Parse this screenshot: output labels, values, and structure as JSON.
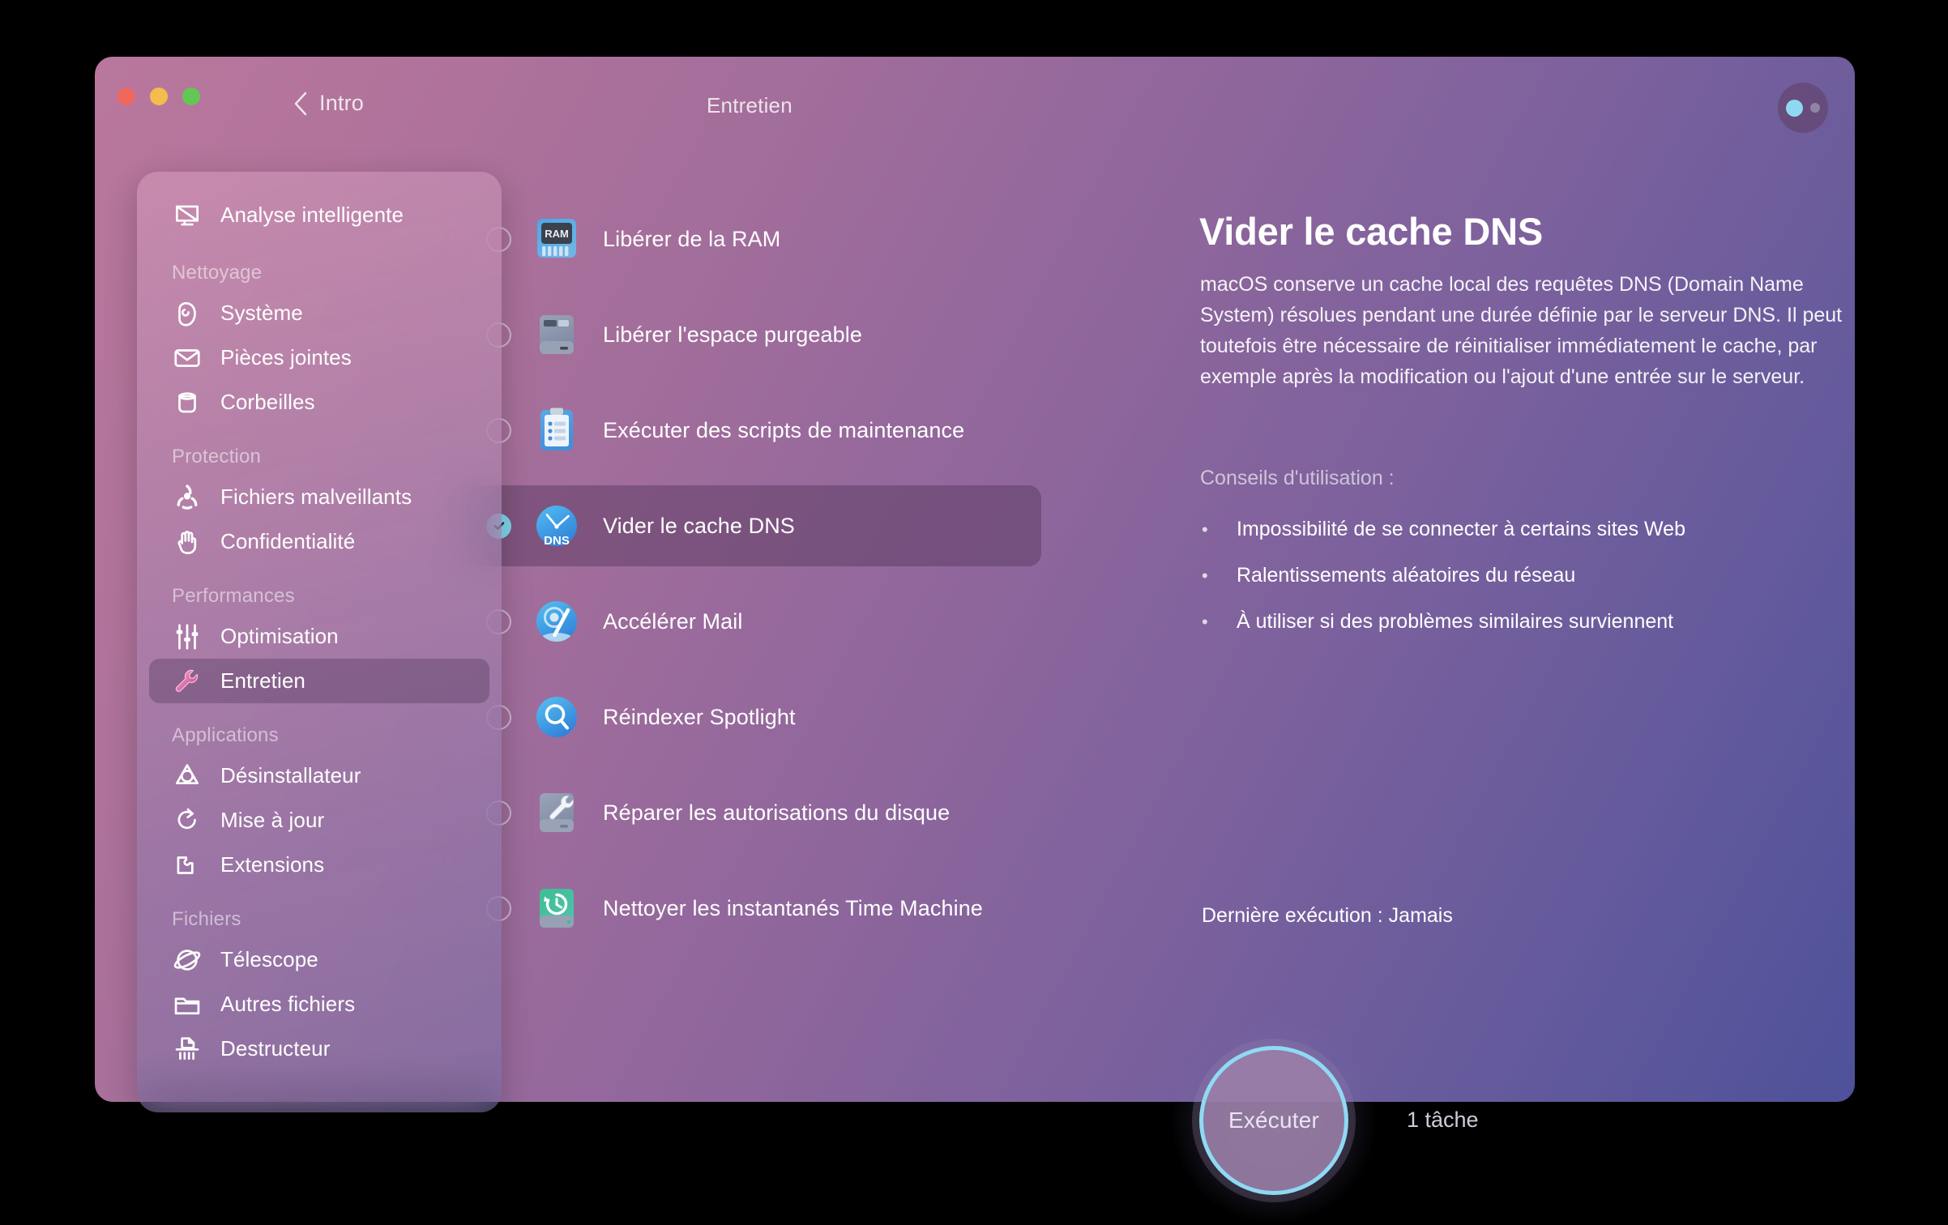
{
  "window": {
    "traffic_lights": [
      "close",
      "minimize",
      "zoom"
    ],
    "back_label": "Intro",
    "section_title": "Entretien",
    "accent_color": "#8fd9f4",
    "window_gradient_from": "#b9779c",
    "window_gradient_to": "#4e519a"
  },
  "sidebar": {
    "top_item": {
      "label": "Analyse intelligente",
      "icon": "smart-scan-icon"
    },
    "groups": [
      {
        "title": "Nettoyage",
        "items": [
          {
            "label": "Système",
            "icon": "system-junk-icon"
          },
          {
            "label": "Pièces jointes",
            "icon": "mail-attachments-icon"
          },
          {
            "label": "Corbeilles",
            "icon": "trash-bins-icon"
          }
        ]
      },
      {
        "title": "Protection",
        "items": [
          {
            "label": "Fichiers malveillants",
            "icon": "biohazard-icon"
          },
          {
            "label": "Confidentialité",
            "icon": "privacy-hand-icon"
          }
        ]
      },
      {
        "title": "Performances",
        "items": [
          {
            "label": "Optimisation",
            "icon": "sliders-icon"
          },
          {
            "label": "Entretien",
            "icon": "wrench-icon",
            "active": true
          }
        ]
      },
      {
        "title": "Applications",
        "items": [
          {
            "label": "Désinstallateur",
            "icon": "uninstaller-icon"
          },
          {
            "label": "Mise à jour",
            "icon": "updater-icon"
          },
          {
            "label": "Extensions",
            "icon": "extensions-puzzle-icon"
          }
        ]
      },
      {
        "title": "Fichiers",
        "items": [
          {
            "label": "Télescope",
            "icon": "space-lens-icon"
          },
          {
            "label": "Autres fichiers",
            "icon": "folder-icon"
          },
          {
            "label": "Destructeur",
            "icon": "shredder-icon"
          }
        ]
      }
    ]
  },
  "tasks": [
    {
      "label": "Libérer de la RAM",
      "icon": "ram-chip-icon",
      "checked": false,
      "selected": false
    },
    {
      "label": "Libérer l'espace purgeable",
      "icon": "purgeable-disk-icon",
      "checked": false,
      "selected": false
    },
    {
      "label": "Exécuter des scripts de maintenance",
      "icon": "clipboard-scripts-icon",
      "checked": false,
      "selected": false
    },
    {
      "label": "Vider le cache DNS",
      "icon": "dns-clock-icon",
      "checked": true,
      "selected": true
    },
    {
      "label": "Accélérer Mail",
      "icon": "speed-up-mail-icon",
      "checked": false,
      "selected": false
    },
    {
      "label": "Réindexer Spotlight",
      "icon": "spotlight-search-icon",
      "checked": false,
      "selected": false
    },
    {
      "label": "Réparer les autorisations du disque",
      "icon": "disk-wrench-icon",
      "checked": false,
      "selected": false
    },
    {
      "label": "Nettoyer les instantanés Time Machine",
      "icon": "time-machine-icon",
      "checked": false,
      "selected": false
    }
  ],
  "detail": {
    "title": "Vider le cache DNS",
    "description": "macOS conserve un cache local des requêtes DNS (Domain Name System) résolues pendant une durée définie par le serveur DNS. Il peut toutefois être nécessaire de réinitialiser immédiatement le cache, par exemple après la modification ou l'ajout d'une entrée sur le serveur.",
    "tips_title": "Conseils d'utilisation :",
    "tips": [
      "Impossibilité de se connecter à certains sites Web",
      "Ralentissements aléatoires du réseau",
      "À utiliser si des problèmes similaires surviennent"
    ],
    "last_run": "Dernière exécution :  Jamais"
  },
  "footer": {
    "run_label": "Exécuter",
    "task_count": "1 tâche"
  }
}
